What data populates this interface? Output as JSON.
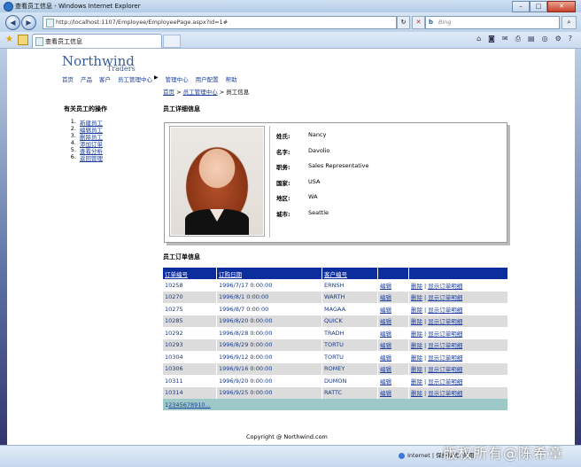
{
  "window": {
    "title": "查看员工信息 - Windows Internet Explorer"
  },
  "address": {
    "url": "http://localhost:1107/Employee/EmployeePage.aspx?id=1#",
    "search_placeholder": "Bing",
    "search_brand": "b"
  },
  "tab": {
    "label": "查看员工信息"
  },
  "logo": {
    "line1": "Northwind",
    "line2": "Traders"
  },
  "topnav": {
    "items": [
      "首页",
      "产品",
      "客户",
      "员工管理中心",
      "管理中心",
      "用户配置",
      "帮助"
    ]
  },
  "breadcrumb": {
    "home": "首页",
    "sep1": ">",
    "center": "员工管理中心",
    "sep2": ">",
    "current": "员工信息"
  },
  "sidebar": {
    "title": "有关员工的操作",
    "items": [
      {
        "num": "1.",
        "label": "新建员工"
      },
      {
        "num": "2.",
        "label": "编辑员工"
      },
      {
        "num": "3.",
        "label": "删除员工"
      },
      {
        "num": "4.",
        "label": "添加订单"
      },
      {
        "num": "5.",
        "label": "查看分析"
      },
      {
        "num": "6.",
        "label": "返回管理"
      }
    ]
  },
  "detail": {
    "title": "员工详细信息",
    "fields": [
      {
        "label": "姓氏:",
        "value": "Nancy"
      },
      {
        "label": "名字:",
        "value": "Davolio"
      },
      {
        "label": "职务:",
        "value": "Sales Representative"
      },
      {
        "label": "国家:",
        "value": "USA"
      },
      {
        "label": "地区:",
        "value": "WA"
      },
      {
        "label": "城市:",
        "value": "Seattle"
      }
    ]
  },
  "orders": {
    "title": "员工订单信息",
    "headers": [
      "订单编号",
      "订购日期",
      "客户编号",
      "",
      ""
    ],
    "edit_label": "编辑",
    "delete_label": "删除",
    "pipe": "|",
    "detail_label": "显示订单明细",
    "rows": [
      [
        "10258",
        "1996/7/17 0:00:00",
        "ERNSH"
      ],
      [
        "10270",
        "1996/8/1 0:00:00",
        "WARTH"
      ],
      [
        "10275",
        "1996/8/7 0:00:00",
        "MAGAA"
      ],
      [
        "10285",
        "1996/8/20 0:00:00",
        "QUICK"
      ],
      [
        "10292",
        "1996/8/28 0:00:00",
        "TRADH"
      ],
      [
        "10293",
        "1996/8/29 0:00:00",
        "TORTU"
      ],
      [
        "10304",
        "1996/9/12 0:00:00",
        "TORTU"
      ],
      [
        "10306",
        "1996/9/16 0:00:00",
        "ROMEY"
      ],
      [
        "10311",
        "1996/9/20 0:00:00",
        "DUMON"
      ],
      [
        "10314",
        "1996/9/25 0:00:00",
        "RATTC"
      ]
    ],
    "pager": [
      "1",
      "2",
      "3",
      "4",
      "5",
      "6",
      "7",
      "8",
      "9",
      "10",
      "..."
    ]
  },
  "footer": {
    "copyright": "Copyright @ Northwind.com"
  },
  "status": {
    "zone": "Internet | 保护模式: 禁用"
  },
  "watermark": {
    "text": "版权所有@陈希章"
  },
  "colors": {
    "header_bg": "#0c2d9c",
    "link": "#1c3fa0",
    "pager_bg": "#9cc8c8",
    "alt_row": "#dcdcdc"
  }
}
